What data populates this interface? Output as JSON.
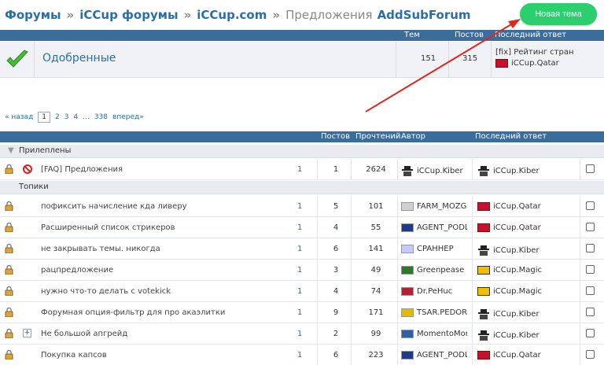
{
  "breadcrumb": {
    "items": [
      "Форумы",
      "iCCup форумы",
      "iCCup.com"
    ],
    "current": "Предложения",
    "subforum": "AddSubForum",
    "sep": "»"
  },
  "new_topic_label": "Новая тема",
  "forum_header": {
    "topics": "Тем",
    "posts": "Постов",
    "last": "Последний ответ"
  },
  "forum": {
    "name": "Одобренные",
    "topics": "151",
    "posts": "315",
    "last_title": "[fix] Рейтинг стран",
    "last_user": "iCCup.Qatar"
  },
  "pager": {
    "prev": "« назад",
    "current": "1",
    "pages": [
      "2",
      "3",
      "4"
    ],
    "dots": "...",
    "last": "338",
    "next": "вперед»"
  },
  "topics_header": {
    "posts": "Постов",
    "views": "Прочтений",
    "author": "Автор",
    "last": "Последний ответ"
  },
  "sections": {
    "pinned": "Прилеплены",
    "topics": "Топики"
  },
  "pinned": [
    {
      "title": "[FAQ] Предложения",
      "pages": "1",
      "posts": "1",
      "views": "2624",
      "author": "iCCup.Kiber",
      "last": "iCCup.Kiber"
    }
  ],
  "topics": [
    {
      "title": "пофиксить начисление кда ливеру",
      "pages": "1",
      "posts": "5",
      "views": "101",
      "author": "FARM_MOZG",
      "last": "iCCup.Qatar"
    },
    {
      "title": "Расширенный список стрикеров",
      "pages": "1",
      "posts": "4",
      "views": "55",
      "author": "AGENT_PODL",
      "last": "iCCup.Qatar"
    },
    {
      "title": "не закрывать темы. никогда",
      "pages": "1",
      "posts": "6",
      "views": "141",
      "author": "CPAHHEP",
      "last": "iCCup.Kiber"
    },
    {
      "title": "рацпредложение",
      "pages": "1",
      "posts": "3",
      "views": "49",
      "author": "Greenpease",
      "last": "iCCup.Magic"
    },
    {
      "title": "нужно что-то делать с votekick",
      "pages": "1",
      "posts": "4",
      "views": "74",
      "author": "Dr.PeHuc",
      "last": "iCCup.Magic"
    },
    {
      "title": "Форумная опция-фильтр для про акаэлитки",
      "pages": "1",
      "posts": "9",
      "views": "171",
      "author": "TSAR.PEDOR",
      "last": "iCCup.Kiber"
    },
    {
      "title": "Не большой апгрейд",
      "pages": "1",
      "posts": "2",
      "views": "99",
      "author": "MomentoMori",
      "last": "iCCup.Kiber"
    },
    {
      "title": "Покупка капсов",
      "pages": "1",
      "posts": "6",
      "views": "223",
      "author": "AGENT_PODL",
      "last": "iCCup.Qatar"
    }
  ],
  "colors": {
    "accent": "#2a6fa8",
    "header": "#3a6c9c",
    "button": "#2bcf6d",
    "arrow": "#e0281e"
  }
}
